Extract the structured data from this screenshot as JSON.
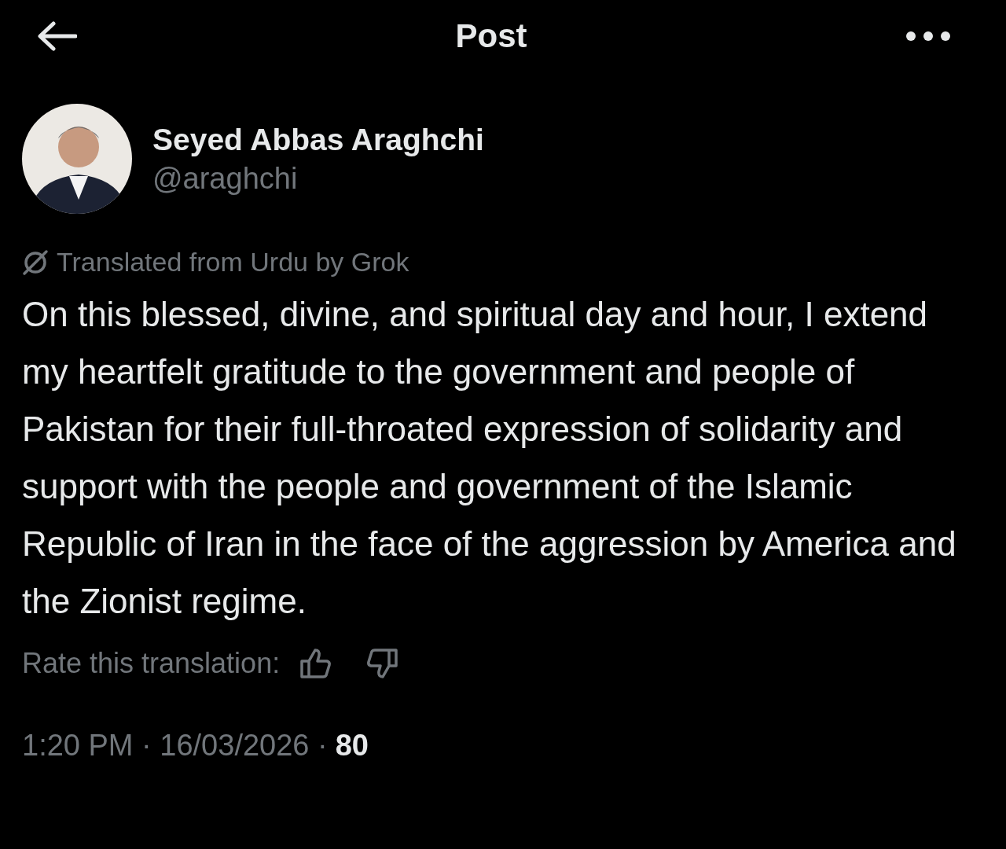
{
  "header": {
    "title": "Post"
  },
  "author": {
    "name": "Seyed Abbas Araghchi",
    "handle": "@araghchi"
  },
  "translation_note": "Translated from Urdu by Grok",
  "body": "On this blessed, divine, and spiritual day and hour, I extend my heartfelt gratitude to the government and people of Pakistan for their full-throated expression of solidarity and support with the people and government of the Islamic Republic of Iran in the face of the aggression by America and the Zionist regime.",
  "rating": {
    "label": "Rate this translation:"
  },
  "meta": {
    "timestamp": "1:20 PM · 16/03/2026 ·",
    "views": "80"
  }
}
